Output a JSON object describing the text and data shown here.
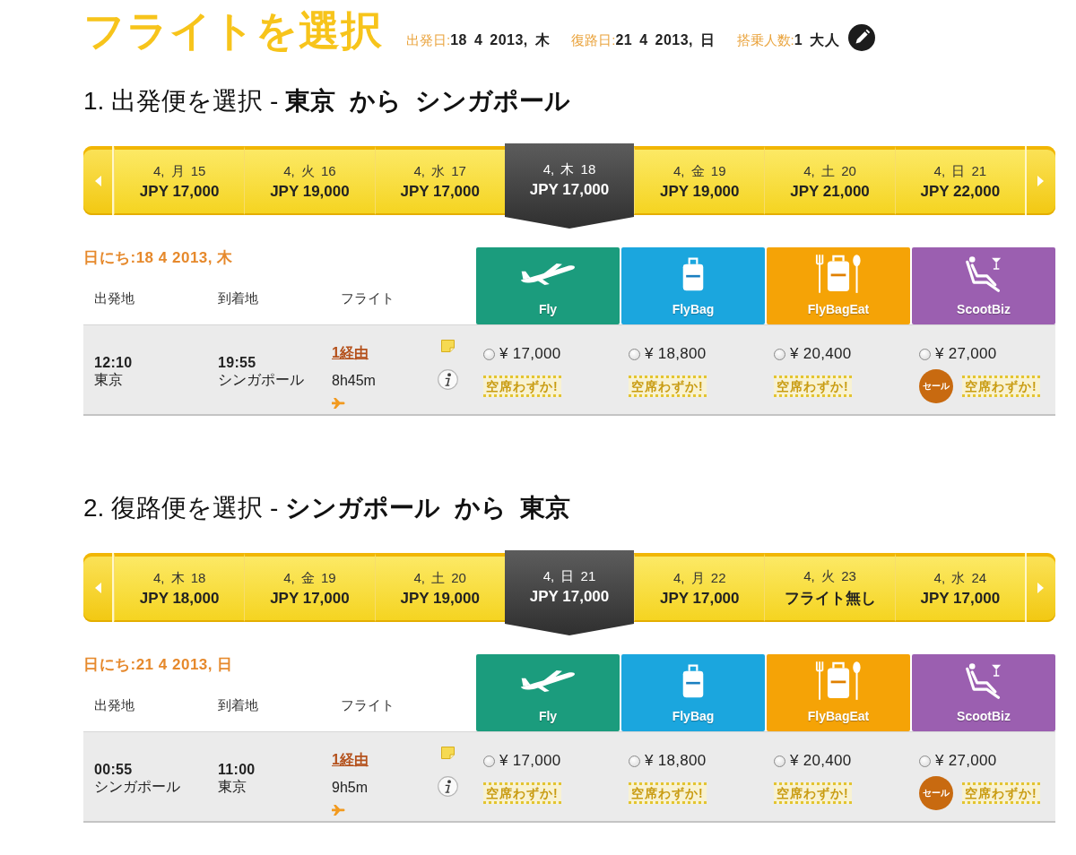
{
  "title": "フライトを選択",
  "summary": [
    {
      "label": "出発日:",
      "value": "18 4 2013, 木"
    },
    {
      "label": "復路日:",
      "value": "21 4 2013, 日"
    },
    {
      "label": "搭乗人数:",
      "value": "1 大人"
    }
  ],
  "legs": [
    {
      "heading": "1. 出発便を選択 - **東京  から  シンガポール**",
      "dates": [
        {
          "date": "4, 月 15",
          "price": "JPY 17,000",
          "selected": false
        },
        {
          "date": "4, 火 16",
          "price": "JPY 19,000",
          "selected": false
        },
        {
          "date": "4, 水 17",
          "price": "JPY 17,000",
          "selected": false
        },
        {
          "date": "4, 木 18",
          "price": "JPY 17,000",
          "selected": true
        },
        {
          "date": "4, 金 19",
          "price": "JPY 19,000",
          "selected": false
        },
        {
          "date": "4, 土 20",
          "price": "JPY 21,000",
          "selected": false
        },
        {
          "date": "4, 日 21",
          "price": "JPY 22,000",
          "selected": false
        }
      ],
      "date_label": "日にち:18 4 2013, 木",
      "columns": [
        "出発地",
        "到着地",
        "フライト"
      ],
      "fare_types": [
        {
          "name": "Fly",
          "kind": "plane",
          "color": "#1b9c7d"
        },
        {
          "name": "FlyBag",
          "kind": "bag",
          "color": "#1ba6de"
        },
        {
          "name": "FlyBagEat",
          "kind": "bag_meal",
          "color": "#f5a306"
        },
        {
          "name": "ScootBiz",
          "kind": "seat",
          "color": "#9b5fb0"
        }
      ],
      "flights": [
        {
          "depart_time": "12:10",
          "depart_city": "東京",
          "arrive_time": "19:55",
          "arrive_city": "シンガポール",
          "stops": "1経由",
          "duration": "8h45m",
          "fares": [
            {
              "price": "¥ 17,000",
              "selected": false,
              "availability": "空席わずか!"
            },
            {
              "price": "¥ 18,800",
              "selected": false,
              "availability": "空席わずか!"
            },
            {
              "price": "¥ 20,400",
              "selected": false,
              "availability": "空席わずか!"
            },
            {
              "price": "¥ 27,000",
              "selected": false,
              "sale": "セール",
              "availability": "空席わずか!"
            }
          ]
        }
      ]
    },
    {
      "heading": "2. 復路便を選択 - **シンガポール  から  東京**",
      "dates": [
        {
          "date": "4, 木 18",
          "price": "JPY 18,000",
          "selected": false
        },
        {
          "date": "4, 金 19",
          "price": "JPY 17,000",
          "selected": false
        },
        {
          "date": "4, 土 20",
          "price": "JPY 19,000",
          "selected": false
        },
        {
          "date": "4, 日 21",
          "price": "JPY 17,000",
          "selected": true
        },
        {
          "date": "4, 月 22",
          "price": "JPY 17,000",
          "selected": false
        },
        {
          "date": "4, 火 23",
          "price": "フライト無し",
          "selected": false
        },
        {
          "date": "4, 水 24",
          "price": "JPY 17,000",
          "selected": false
        }
      ],
      "date_label": "日にち:21 4 2013, 日",
      "columns": [
        "出発地",
        "到着地",
        "フライト"
      ],
      "fare_types": [
        {
          "name": "Fly",
          "kind": "plane",
          "color": "#1b9c7d"
        },
        {
          "name": "FlyBag",
          "kind": "bag",
          "color": "#1ba6de"
        },
        {
          "name": "FlyBagEat",
          "kind": "bag_meal",
          "color": "#f5a306"
        },
        {
          "name": "ScootBiz",
          "kind": "seat",
          "color": "#9b5fb0"
        }
      ],
      "flights": [
        {
          "depart_time": "00:55",
          "depart_city": "シンガポール",
          "arrive_time": "11:00",
          "arrive_city": "東京",
          "stops": "1経由",
          "duration": "9h5m",
          "fares": [
            {
              "price": "¥ 17,000",
              "selected": false,
              "availability": "空席わずか!"
            },
            {
              "price": "¥ 18,800",
              "selected": false,
              "availability": "空席わずか!"
            },
            {
              "price": "¥ 20,400",
              "selected": false,
              "availability": "空席わずか!"
            },
            {
              "price": "¥ 27,000",
              "selected": false,
              "sale": "セール",
              "availability": "空席わずか!"
            }
          ]
        }
      ]
    }
  ]
}
